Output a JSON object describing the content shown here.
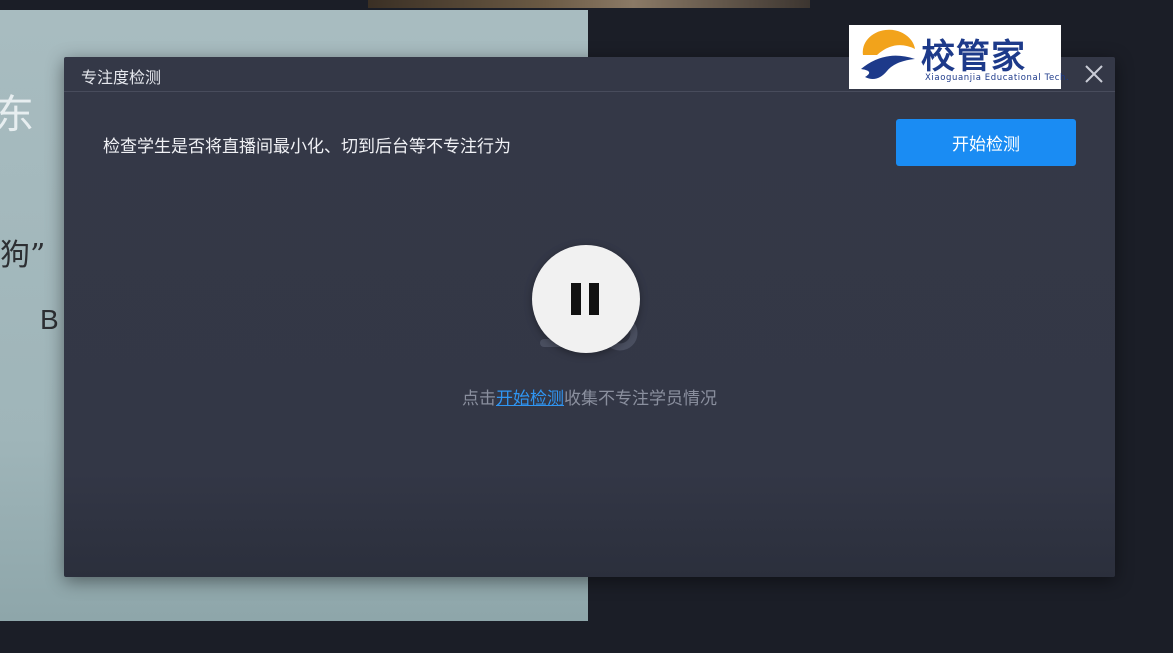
{
  "slide": {
    "fragment_top": "东",
    "fragment_mid": "狗”",
    "fragment_bottom": "B"
  },
  "modal": {
    "title": "专注度检测",
    "description": "检查学生是否将直播间最小化、切到后台等不专注行为",
    "start_button_label": "开始检测",
    "hint_prefix": "点击",
    "hint_link": "开始检测",
    "hint_suffix": "收集不专注学员情况"
  },
  "logo": {
    "name": "校管家",
    "subtitle": "Xiaoguanjia Educational Tech."
  },
  "colors": {
    "accent": "#1a8cf3",
    "modal_bg": "#343847",
    "link": "#2f95f2",
    "logo_blue": "#1d3a8a",
    "logo_orange": "#f2a31b"
  },
  "icons": {
    "close": "close-icon",
    "pause": "pause-icon",
    "empty": "magnifier-empty-icon"
  }
}
